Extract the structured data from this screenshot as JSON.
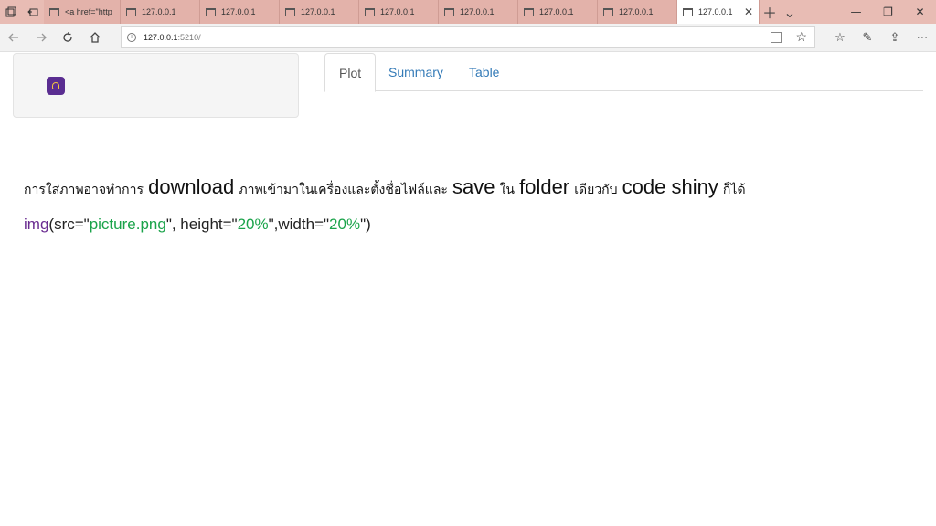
{
  "browser": {
    "tabs": [
      {
        "label": "<a href=\"http"
      },
      {
        "label": "127.0.0.1"
      },
      {
        "label": "127.0.0.1"
      },
      {
        "label": "127.0.0.1"
      },
      {
        "label": "127.0.0.1"
      },
      {
        "label": "127.0.0.1"
      },
      {
        "label": "127.0.0.1"
      },
      {
        "label": "127.0.0.1"
      },
      {
        "label": "127.0.0.1"
      }
    ],
    "address": {
      "host": "127.0.0.1",
      "port": ":5210/"
    },
    "tab_strip_color": "#e8bcb4"
  },
  "page": {
    "tabs": [
      {
        "label": "Plot"
      },
      {
        "label": "Summary"
      },
      {
        "label": "Table"
      }
    ],
    "active_tab": "Plot",
    "instruction": {
      "seg1": "การใส่ภาพอาจทำการ",
      "word1": "download",
      "seg2": "ภาพเข้ามาในเครื่องและตั้งชื่อไฟล์และ",
      "word2": "save",
      "seg3": "ใน",
      "word3": "folder",
      "seg4": "เดียวกับ",
      "word4": "code shiny",
      "seg5": "ก็ได้"
    },
    "code": {
      "fn": "img",
      "p1": "(src=\"",
      "s1": "picture.png",
      "p2": "\", height=\"",
      "s2": "20%",
      "p3": "\",width=\"",
      "s3": "20%",
      "p4": "\")"
    },
    "colors": {
      "link": "#337ab7",
      "function": "#6a2c91",
      "string": "#1aa34a",
      "logo_bg": "#5a2d91"
    }
  }
}
